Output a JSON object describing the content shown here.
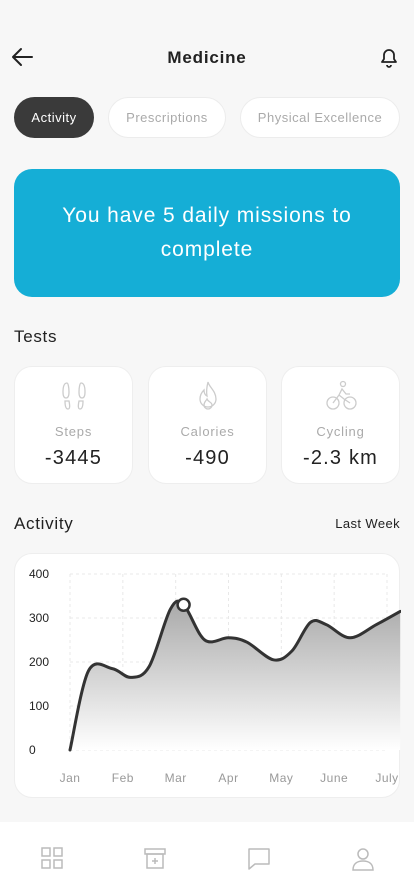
{
  "header": {
    "title": "Medicine",
    "back_icon": "back-arrow-icon",
    "bell_icon": "bell-icon"
  },
  "tabs": [
    {
      "label": "Activity",
      "active": true
    },
    {
      "label": "Prescriptions",
      "active": false
    },
    {
      "label": "Physical Excellence",
      "active": false
    }
  ],
  "banner": {
    "text": "You have 5 daily missions to complete",
    "color": "#15aed6"
  },
  "tests": {
    "title": "Tests",
    "items": [
      {
        "label": "Steps",
        "value": "-3445",
        "icon": "footprints-icon"
      },
      {
        "label": "Calories",
        "value": "-490",
        "icon": "flame-icon"
      },
      {
        "label": "Cycling",
        "value": "-2.3 km",
        "icon": "cyclist-icon"
      }
    ]
  },
  "activity": {
    "title": "Activity",
    "period": "Last Week"
  },
  "chart_data": {
    "type": "area",
    "x": [
      "Jan",
      "Feb",
      "Mar",
      "Apr",
      "May",
      "June",
      "July"
    ],
    "y_ticks": [
      400,
      300,
      200,
      100,
      0
    ],
    "ylim": [
      0,
      400
    ],
    "grid": true,
    "series": [
      {
        "values": [
          [
            0,
            0
          ],
          [
            0.35,
            180
          ],
          [
            0.8,
            185
          ],
          [
            1.15,
            165
          ],
          [
            1.5,
            190
          ],
          [
            1.9,
            320
          ],
          [
            2.15,
            330
          ],
          [
            2.55,
            250
          ],
          [
            3.0,
            255
          ],
          [
            3.35,
            245
          ],
          [
            3.85,
            205
          ],
          [
            4.2,
            225
          ],
          [
            4.55,
            290
          ],
          [
            4.85,
            285
          ],
          [
            5.3,
            255
          ],
          [
            5.8,
            285
          ],
          [
            6.25,
            315
          ]
        ]
      }
    ],
    "highlight": {
      "x": 2.15,
      "y": 330
    },
    "color": "#333333"
  },
  "bottom_nav": [
    {
      "icon": "grid-icon"
    },
    {
      "icon": "medicine-box-icon"
    },
    {
      "icon": "chat-icon"
    },
    {
      "icon": "profile-icon"
    }
  ]
}
